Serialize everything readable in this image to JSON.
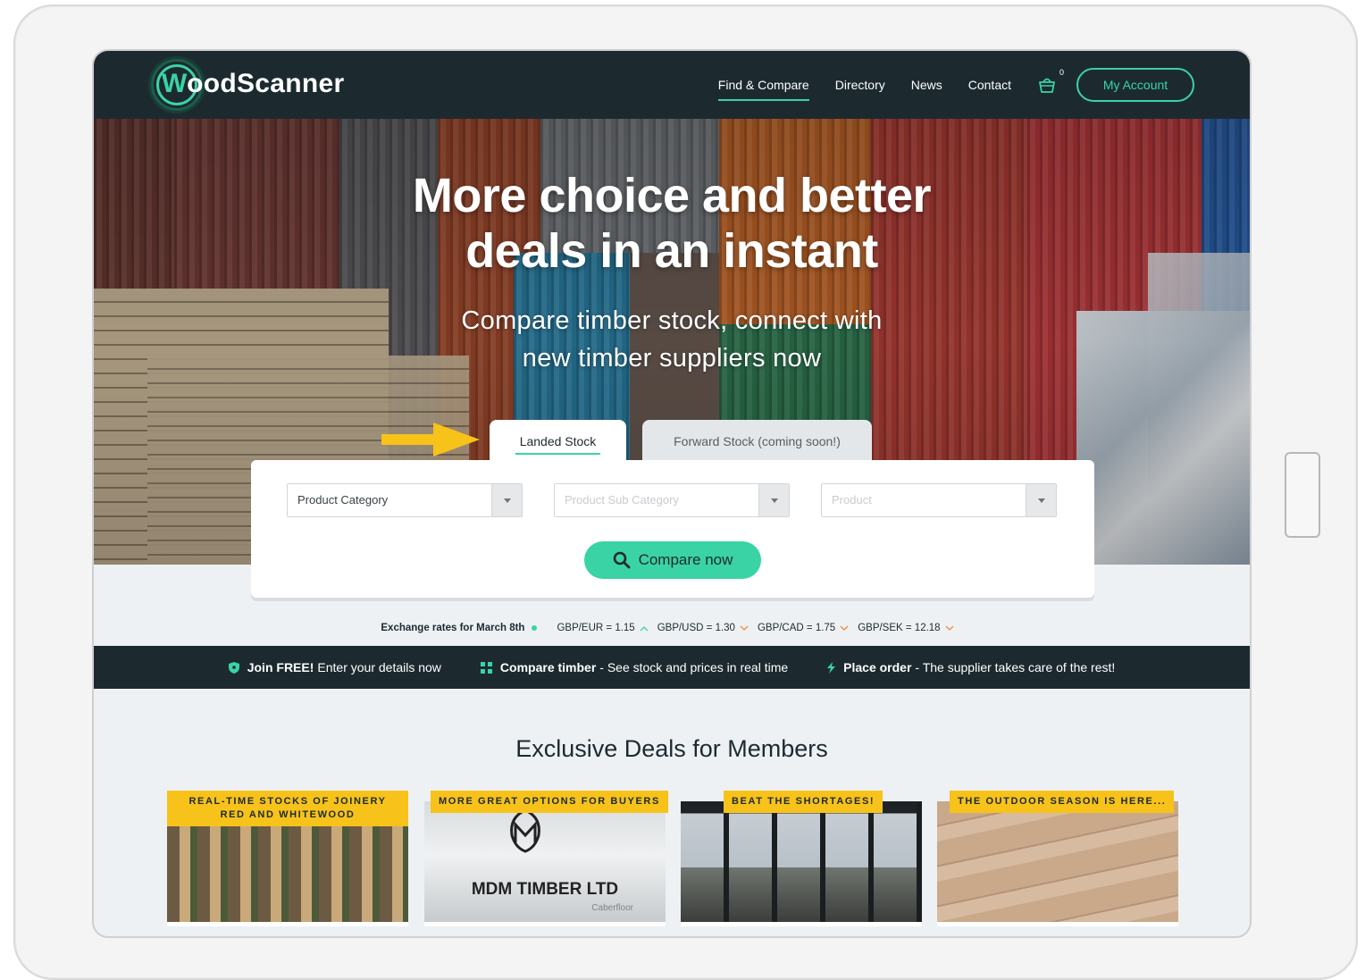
{
  "header": {
    "logo_text_w": "W",
    "logo_text_rest": "oodScanner",
    "nav": [
      {
        "label": "Find & Compare",
        "active": true
      },
      {
        "label": "Directory",
        "active": false
      },
      {
        "label": "News",
        "active": false
      },
      {
        "label": "Contact",
        "active": false
      }
    ],
    "cart_icon": "basket-icon",
    "cart_count": "0",
    "account_label": "My Account"
  },
  "hero": {
    "title_line1": "More choice and better",
    "title_line2": "deals in an instant",
    "subtitle_line1": "Compare timber stock, connect with",
    "subtitle_line2": "new timber suppliers now"
  },
  "tabs": {
    "landed": "Landed Stock",
    "forward": "Forward Stock (coming soon!)",
    "arrow_color": "#f7c21a"
  },
  "search": {
    "category": "Product Category",
    "sub_category": "Product Sub Category",
    "product": "Product",
    "compare_label": "Compare now"
  },
  "rates": {
    "title": "Exchange rates for March 8th",
    "items": [
      {
        "label": "GBP/EUR = 1.15",
        "trend": "up"
      },
      {
        "label": "GBP/USD = 1.30",
        "trend": "down"
      },
      {
        "label": "GBP/CAD = 1.75",
        "trend": "down"
      },
      {
        "label": "GBP/SEK = 12.18",
        "trend": "down"
      }
    ]
  },
  "infobar": {
    "join_bold": "Join FREE!",
    "join_text": "Enter your details now",
    "compare_bold": "Compare timber",
    "compare_text": "- See stock and prices in real time",
    "order_bold": "Place order",
    "order_text": "- The supplier takes care of the rest!"
  },
  "deals": {
    "title": "Exclusive Deals for Members",
    "cards": [
      {
        "badge": "REAL-TIME STOCKS OF JOINERY RED AND WHITEWOOD"
      },
      {
        "badge": "MORE GREAT OPTIONS FOR BUYERS",
        "logo_text": "MDM TIMBER LTD",
        "sub_logo": "Caberfloor"
      },
      {
        "badge": "BEAT THE SHORTAGES!"
      },
      {
        "badge": "THE OUTDOOR SEASON IS HERE..."
      }
    ]
  },
  "colors": {
    "brand_dark": "#1c2a30",
    "accent": "#3ad3a5",
    "badge": "#f7c21a",
    "rate_up": "#3ad3a5",
    "rate_down": "#f08a3e"
  }
}
